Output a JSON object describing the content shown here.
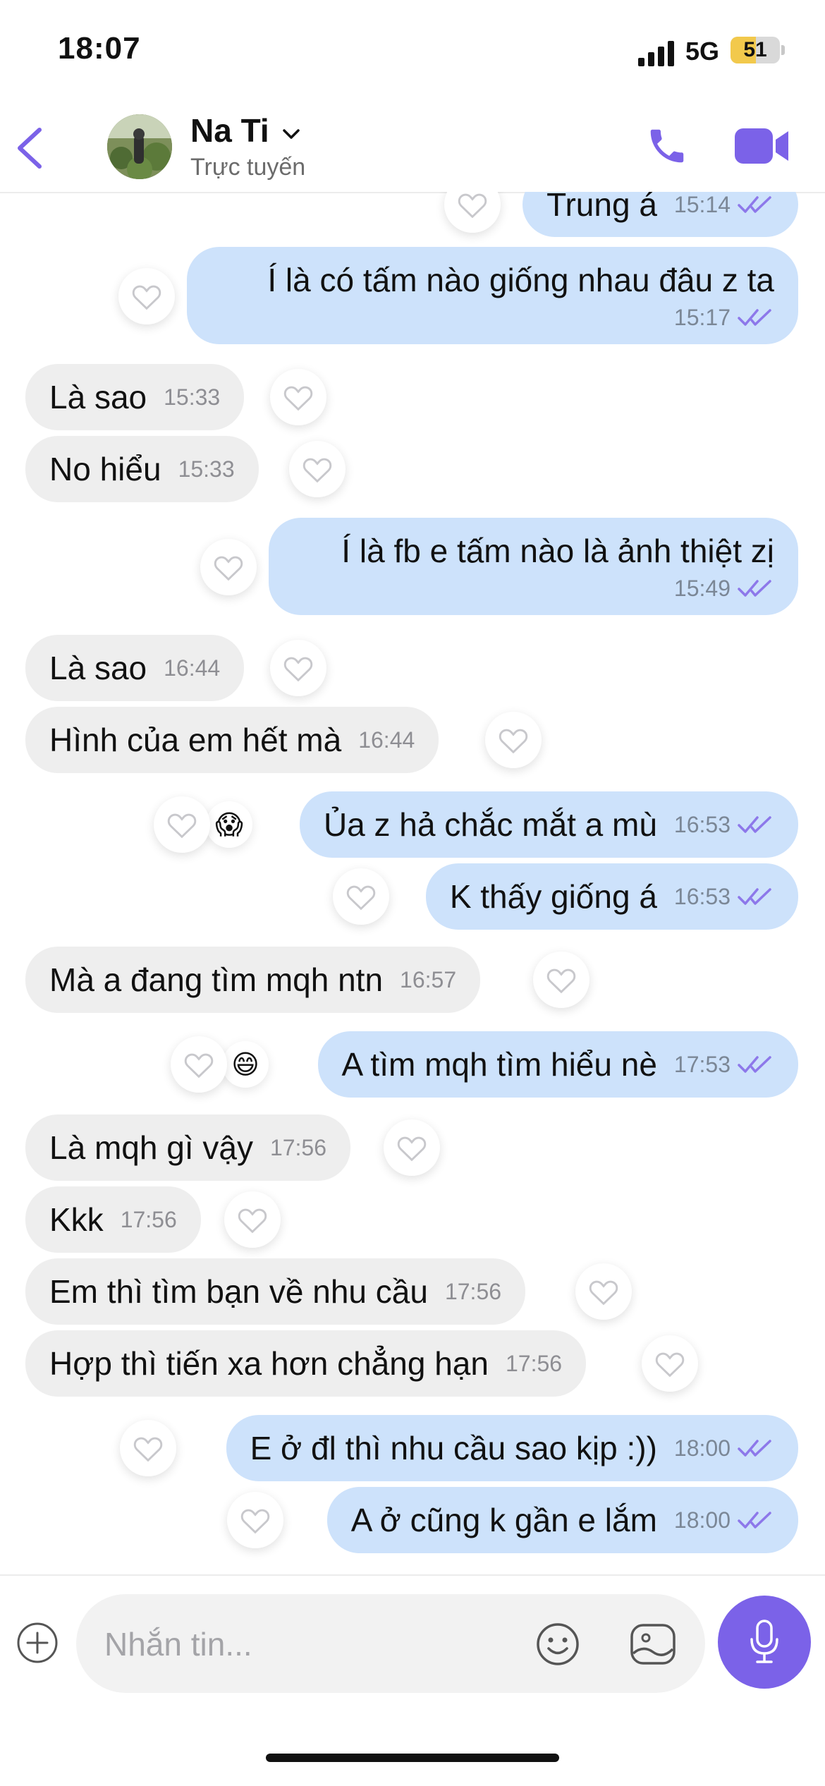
{
  "status_bar": {
    "time": "18:07",
    "network": "5G",
    "battery": "51",
    "battery_level": 0.51
  },
  "header": {
    "name": "Na Ti",
    "status": "Trực tuyến",
    "accent": "#7b62e8"
  },
  "messages": [
    {
      "dir": "out",
      "text": "Trung á",
      "time": "15:14"
    },
    {
      "dir": "out",
      "text": "Í là có tấm nào giống nhau đâu z ta",
      "time": "15:17"
    },
    {
      "dir": "in",
      "text": "Là sao",
      "time": "15:33"
    },
    {
      "dir": "in",
      "text": "No hiểu",
      "time": "15:33"
    },
    {
      "dir": "out",
      "text": "Í là fb e tấm nào là ảnh thiệt zị",
      "time": "15:49"
    },
    {
      "dir": "in",
      "text": "Là sao",
      "time": "16:44"
    },
    {
      "dir": "in",
      "text": "Hình của em hết mà",
      "time": "16:44"
    },
    {
      "dir": "out",
      "text": "Ủa z hả chắc mắt a mù",
      "time": "16:53",
      "reaction": "😱"
    },
    {
      "dir": "out",
      "text": "K thấy giống á",
      "time": "16:53"
    },
    {
      "dir": "in",
      "text": "Mà a đang tìm mqh ntn",
      "time": "16:57"
    },
    {
      "dir": "out",
      "text": "A tìm mqh tìm hiểu nè",
      "time": "17:53",
      "reaction": "😄"
    },
    {
      "dir": "in",
      "text": "Là mqh gì vậy",
      "time": "17:56"
    },
    {
      "dir": "in",
      "text": "Kkk",
      "time": "17:56"
    },
    {
      "dir": "in",
      "text": "Em thì tìm bạn về nhu cầu",
      "time": "17:56"
    },
    {
      "dir": "in",
      "text": "Hợp thì tiến xa hơn chẳng hạn",
      "time": "17:56"
    },
    {
      "dir": "out",
      "text": "E ở đl thì nhu cầu sao kịp :))",
      "time": "18:00"
    },
    {
      "dir": "out",
      "text": "A ở cũng k gần e lắm",
      "time": "18:00"
    }
  ],
  "composer": {
    "placeholder": "Nhắn tin..."
  },
  "icons": {
    "back": "chevron-left-icon",
    "call": "phone-icon",
    "video": "video-camera-icon",
    "heart": "heart-outline-icon",
    "ticks": "double-check-icon",
    "plus": "plus-circle-icon",
    "emoji": "smiley-icon",
    "gallery": "image-icon",
    "mic": "microphone-icon"
  }
}
